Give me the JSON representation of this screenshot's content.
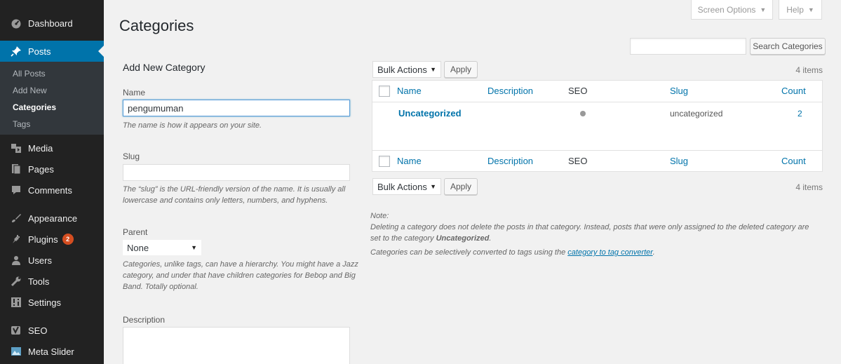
{
  "sidebar": {
    "items": [
      {
        "label": "Dashboard",
        "icon": "dashboard-icon"
      },
      {
        "label": "Posts",
        "icon": "pin-icon"
      },
      {
        "label": "Media",
        "icon": "media-icon"
      },
      {
        "label": "Pages",
        "icon": "pages-icon"
      },
      {
        "label": "Comments",
        "icon": "comments-icon"
      },
      {
        "label": "Appearance",
        "icon": "appearance-icon"
      },
      {
        "label": "Plugins",
        "icon": "plugins-icon",
        "badge": "2"
      },
      {
        "label": "Users",
        "icon": "users-icon"
      },
      {
        "label": "Tools",
        "icon": "tools-icon"
      },
      {
        "label": "Settings",
        "icon": "settings-icon"
      },
      {
        "label": "SEO",
        "icon": "seo-icon"
      },
      {
        "label": "Meta Slider",
        "icon": "meta-slider-icon"
      }
    ],
    "posts_submenu": [
      "All Posts",
      "Add New",
      "Categories",
      "Tags"
    ],
    "active_submenu": "Categories"
  },
  "screen_meta": {
    "screen_options": "Screen Options",
    "help": "Help"
  },
  "page": {
    "title": "Categories"
  },
  "search": {
    "button_label": "Search Categories",
    "value": ""
  },
  "form": {
    "heading": "Add New Category",
    "name_label": "Name",
    "name_value": "pengumuman",
    "name_help": "The name is how it appears on your site.",
    "slug_label": "Slug",
    "slug_value": "",
    "slug_help": "The “slug” is the URL-friendly version of the name. It is usually all lowercase and contains only letters, numbers, and hyphens.",
    "parent_label": "Parent",
    "parent_value": "None",
    "parent_help": "Categories, unlike tags, can have a hierarchy. You might have a Jazz category, and under that have children categories for Bebop and Big Band. Totally optional.",
    "description_label": "Description"
  },
  "table": {
    "bulk_actions": "Bulk Actions",
    "apply": "Apply",
    "items_count": "4 items",
    "columns": [
      "Name",
      "Description",
      "SEO",
      "Slug",
      "Count"
    ],
    "rows": [
      {
        "name": "Uncategorized",
        "description": "",
        "seo_status": "grey",
        "slug": "uncategorized",
        "count": "2"
      }
    ]
  },
  "note": {
    "title": "Note:",
    "line1_a": "Deleting a category does not delete the posts in that category. Instead, posts that were only assigned to the deleted category are",
    "line1_b": "set to the category ",
    "default_category": "Uncategorized",
    "line1_end": ".",
    "line2_a": "Categories can be selectively converted to tags using the ",
    "link": "category to tag converter",
    "line2_end": "."
  },
  "colors": {
    "accent": "#0073aa",
    "sidebar_bg": "#222222",
    "badge": "#d54e21",
    "background": "#f1f1f1"
  }
}
